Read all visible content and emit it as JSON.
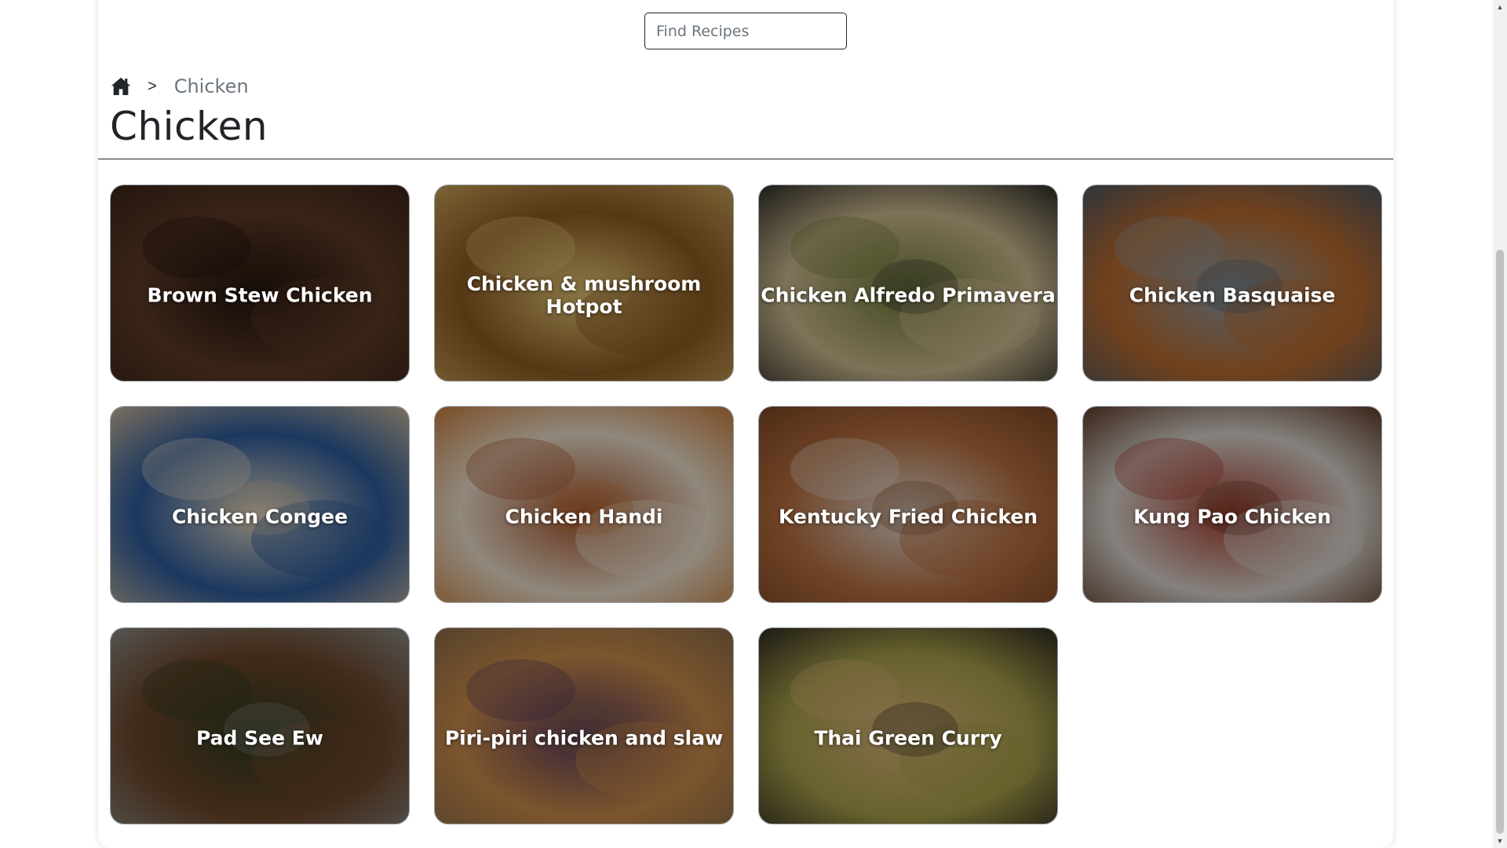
{
  "search": {
    "placeholder": "Find Recipes",
    "value": ""
  },
  "breadcrumb": {
    "home_icon": "home-icon",
    "separator": ">",
    "current": "Chicken"
  },
  "page_title": "Chicken",
  "recipes": [
    {
      "name": "Brown Stew Chicken",
      "colors": [
        "#3a2418",
        "#5c3a26",
        "#1e120c"
      ]
    },
    {
      "name": "Chicken & mushroom Hotpot",
      "colors": [
        "#c8a25a",
        "#8a5a22",
        "#e6c77a"
      ]
    },
    {
      "name": "Chicken Alfredo Primavera",
      "colors": [
        "#2b2a26",
        "#cbb98e",
        "#6f7a3a"
      ]
    },
    {
      "name": "Chicken Basquaise",
      "colors": [
        "#4a5560",
        "#b86a2e",
        "#8a9aa3"
      ]
    },
    {
      "name": "Chicken Congee",
      "colors": [
        "#c9b79a",
        "#2d5a9a",
        "#e3d7bf"
      ]
    },
    {
      "name": "Chicken Handi",
      "colors": [
        "#c67a3a",
        "#e8dcc8",
        "#a4502a"
      ]
    },
    {
      "name": "Kentucky Fried Chicken",
      "colors": [
        "#7a4524",
        "#b56d3e",
        "#e0dad2"
      ]
    },
    {
      "name": "Kung Pao Chicken",
      "colors": [
        "#5a3622",
        "#d7d2cc",
        "#a43a2a"
      ]
    },
    {
      "name": "Pad See Ew",
      "colors": [
        "#8a8a86",
        "#6a4428",
        "#2f3a20"
      ]
    },
    {
      "name": "Piri-piri chicken and slaw",
      "colors": [
        "#8a6a4a",
        "#c88a4a",
        "#5a3a5a"
      ]
    },
    {
      "name": "Thai Green Curry",
      "colors": [
        "#2b2620",
        "#a8a04a",
        "#d9b27a"
      ]
    }
  ],
  "colors": {
    "text": "#212529",
    "muted": "#6c757d",
    "card_overlay": "rgba(0,0,0,0.38)"
  }
}
